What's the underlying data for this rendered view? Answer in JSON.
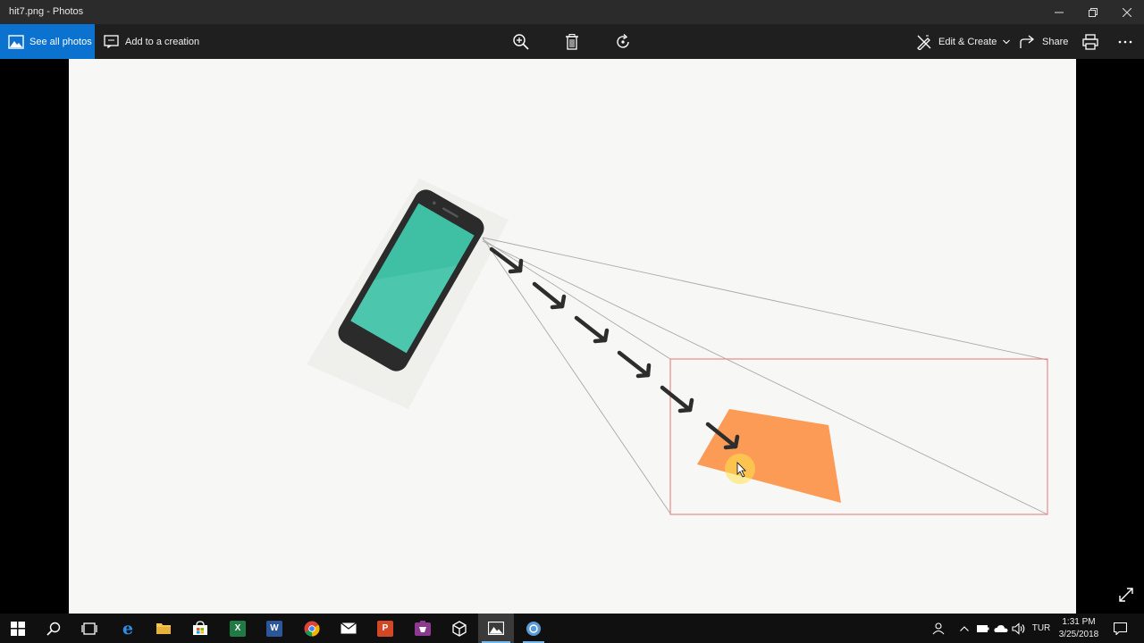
{
  "window": {
    "title": "hit7.png - Photos"
  },
  "toolbar": {
    "see_all_photos": "See all photos",
    "add_to_creation": "Add to a creation",
    "edit_create": "Edit & Create",
    "share": "Share"
  },
  "taskbar": {
    "language": "TUR",
    "time": "1:31 PM",
    "date": "3/25/2018"
  },
  "colors": {
    "accent": "#0b72d0",
    "phone_screen": "#3fbfa4",
    "orange_shape": "#fb9b56",
    "bounding_box": "#e98a8a",
    "arrow": "#2d2d2d"
  }
}
